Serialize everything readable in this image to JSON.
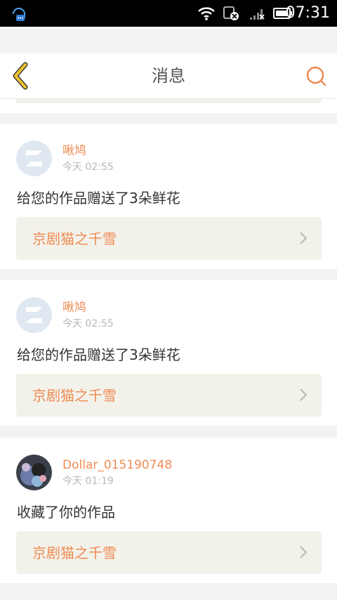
{
  "status_bar": {
    "time": "07:31",
    "icons": [
      "notification-icon",
      "wifi-icon",
      "data-off-icon",
      "signal-icon",
      "battery-icon"
    ]
  },
  "header": {
    "title": "消息",
    "icons": [
      "back-chevron-icon",
      "search-icon"
    ]
  },
  "colors": {
    "accent": "#ee8c55",
    "back_icon": "#f0c22e",
    "card_link_bg": "#f3f2ea"
  },
  "messages": [
    {
      "username": "啾鸠",
      "time": "今天 02:55",
      "text": "给您的作品赠送了3朵鲜花",
      "work_title": "京剧猫之千雪",
      "avatar": "default-avatar-icon"
    },
    {
      "username": "啾鸠",
      "time": "今天 02:55",
      "text": "给您的作品赠送了3朵鲜花",
      "work_title": "京剧猫之千雪",
      "avatar": "default-avatar-icon"
    },
    {
      "username": "Dollar_015190748",
      "time": "今天 01:19",
      "text": "收藏了你的作品",
      "work_title": "京剧猫之千雪",
      "avatar": "user-photo-avatar"
    }
  ]
}
